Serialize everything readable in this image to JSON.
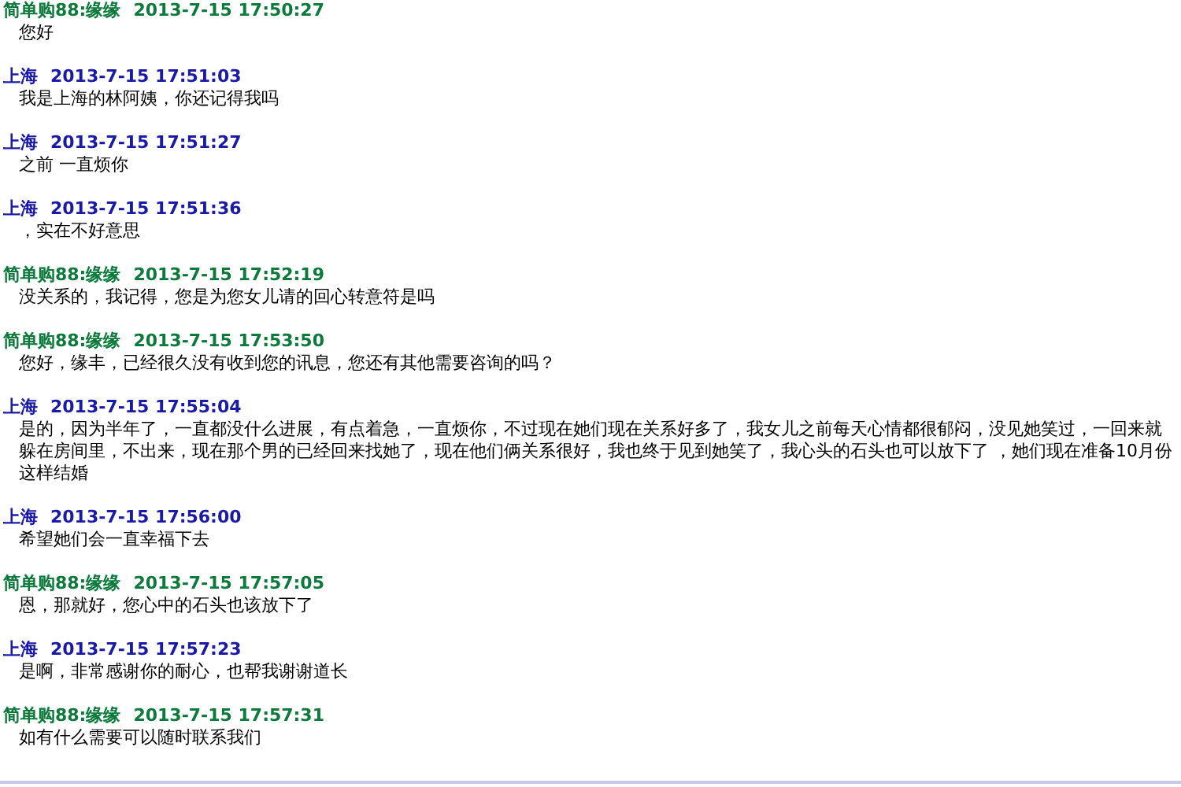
{
  "messages": [
    {
      "kind": "agent",
      "sender": "简单购88:缘缘",
      "time": "2013-7-15 17:50:27",
      "text": "您好"
    },
    {
      "kind": "customer",
      "sender": "上海",
      "time": "2013-7-15 17:51:03",
      "text": "我是上海的林阿姨，你还记得我吗"
    },
    {
      "kind": "customer",
      "sender": "上海",
      "time": "2013-7-15 17:51:27",
      "text": "之前 一直烦你"
    },
    {
      "kind": "customer",
      "sender": "上海",
      "time": "2013-7-15 17:51:36",
      "text": "，实在不好意思"
    },
    {
      "kind": "agent",
      "sender": "简单购88:缘缘",
      "time": "2013-7-15 17:52:19",
      "text": "没关系的，我记得，您是为您女儿请的回心转意符是吗"
    },
    {
      "kind": "agent",
      "sender": "简单购88:缘缘",
      "time": "2013-7-15 17:53:50",
      "text": "您好，缘丰，已经很久没有收到您的讯息，您还有其他需要咨询的吗？"
    },
    {
      "kind": "customer",
      "sender": "上海",
      "time": "2013-7-15 17:55:04",
      "text": "是的，因为半年了，一直都没什么进展，有点着急，一直烦你，不过现在她们现在关系好多了，我女儿之前每天心情都很郁闷，没见她笑过，一回来就躲在房间里，不出来，现在那个男的已经回来找她了，现在他们俩关系很好，我也终于见到她笑了，我心头的石头也可以放下了 ，她们现在准备10月份这样结婚"
    },
    {
      "kind": "customer",
      "sender": "上海",
      "time": "2013-7-15 17:56:00",
      "text": "希望她们会一直幸福下去"
    },
    {
      "kind": "agent",
      "sender": "简单购88:缘缘",
      "time": "2013-7-15 17:57:05",
      "text": "恩，那就好，您心中的石头也该放下了"
    },
    {
      "kind": "customer",
      "sender": "上海",
      "time": "2013-7-15 17:57:23",
      "text": "是啊，非常感谢你的耐心，也帮我谢谢道长"
    },
    {
      "kind": "agent",
      "sender": "简单购88:缘缘",
      "time": "2013-7-15 17:57:31",
      "text": "如有什么需要可以随时联系我们"
    }
  ]
}
